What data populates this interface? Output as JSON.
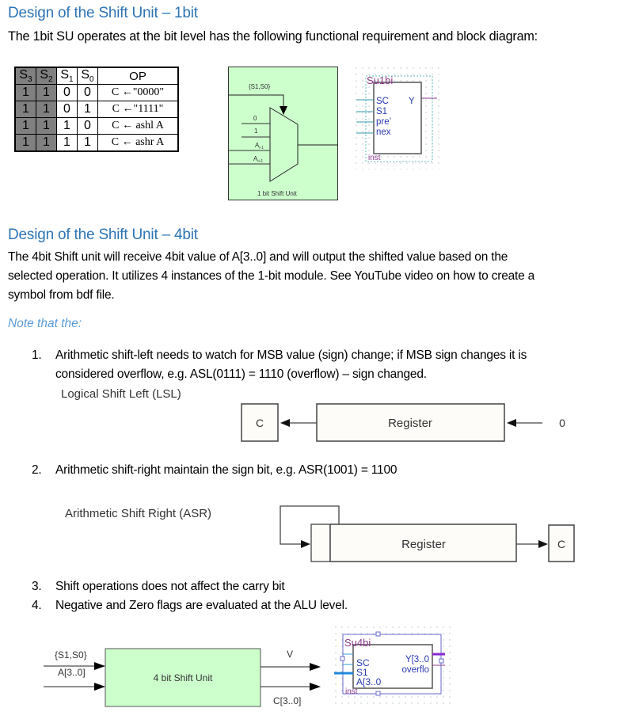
{
  "section1": {
    "heading": "Design of the Shift Unit – 1bit",
    "intro": "The 1bit SU operates at the bit level has the following functional requirement and block diagram:"
  },
  "truth_table": {
    "headers": [
      "S",
      "S",
      "S",
      "S",
      "OP"
    ],
    "header_subscripts": [
      "3",
      "2",
      "1",
      "0",
      ""
    ],
    "rows": [
      {
        "s3": "1",
        "s2": "1",
        "s1": "0",
        "s0": "0",
        "op": "C ←\"0000\""
      },
      {
        "s3": "1",
        "s2": "1",
        "s1": "0",
        "s0": "1",
        "op": "C ←\"1111\""
      },
      {
        "s3": "1",
        "s2": "1",
        "s1": "1",
        "s0": "0",
        "op": "C ← ashl A"
      },
      {
        "s3": "1",
        "s2": "1",
        "s1": "1",
        "s0": "1",
        "op": "C ← ashr A"
      }
    ]
  },
  "mux_diagram": {
    "select_label": "{S1,S0}",
    "inputs": [
      "0",
      "1",
      "A",
      "A"
    ],
    "input_subscripts": [
      "",
      "",
      "i-1",
      "i+1"
    ],
    "caption": "1 bit Shift Unit",
    "fill_color": "#ccffcc"
  },
  "symbol_1bit": {
    "name": "Su1bi",
    "ports_in": [
      "SC",
      "S1",
      "pre’",
      "nex"
    ],
    "port_out": "Y",
    "instance": "inst"
  },
  "section2": {
    "heading": "Design of the Shift Unit – 4bit",
    "paragraph_lines": [
      "The 4bit Shift unit will receive 4bit value of A[3..0] and will output the shifted value based on the",
      "selected operation. It utilizes 4 instances of the 1-bit module. See YouTube video on how to create a",
      "symbol from bdf file."
    ],
    "note": "Note that the:"
  },
  "list": {
    "item1": {
      "num": "1.",
      "lines": [
        "Arithmetic shift-left needs to watch for MSB value (sign) change; if MSB sign changes it is",
        "considered overflow, e.g. ASL(0111) = 1110 (overflow) – sign changed."
      ]
    },
    "item2": {
      "num": "2.",
      "text": "Arithmetic shift-right maintain the sign bit, e.g. ASR(1001) = 1100"
    },
    "item3": {
      "num": "3.",
      "text": "Shift operations does not affect the carry bit"
    },
    "item4": {
      "num": "4.",
      "text": "Negative and Zero flags are evaluated at the ALU level."
    }
  },
  "lsl_diagram": {
    "title": "Logical Shift Left (LSL)",
    "carry": "C",
    "register": "Register",
    "fill_in": "0"
  },
  "asr_diagram": {
    "title": "Arithmetic Shift Right (ASR)",
    "register": "Register",
    "carry": "C"
  },
  "block_4bit": {
    "title": "4 bit Shift Unit",
    "in_select": "{S1,S0}",
    "in_data": "A[3..0]",
    "out_overflow": "V",
    "out_data": "C[3..0]",
    "fill_color": "#ccffcc"
  },
  "symbol_4bit": {
    "name": "Su4bi",
    "ports_in": [
      "SC",
      "S1",
      "A[3..0"
    ],
    "ports_out": [
      "Y[3..0",
      "overflo"
    ],
    "instance": "inst"
  }
}
